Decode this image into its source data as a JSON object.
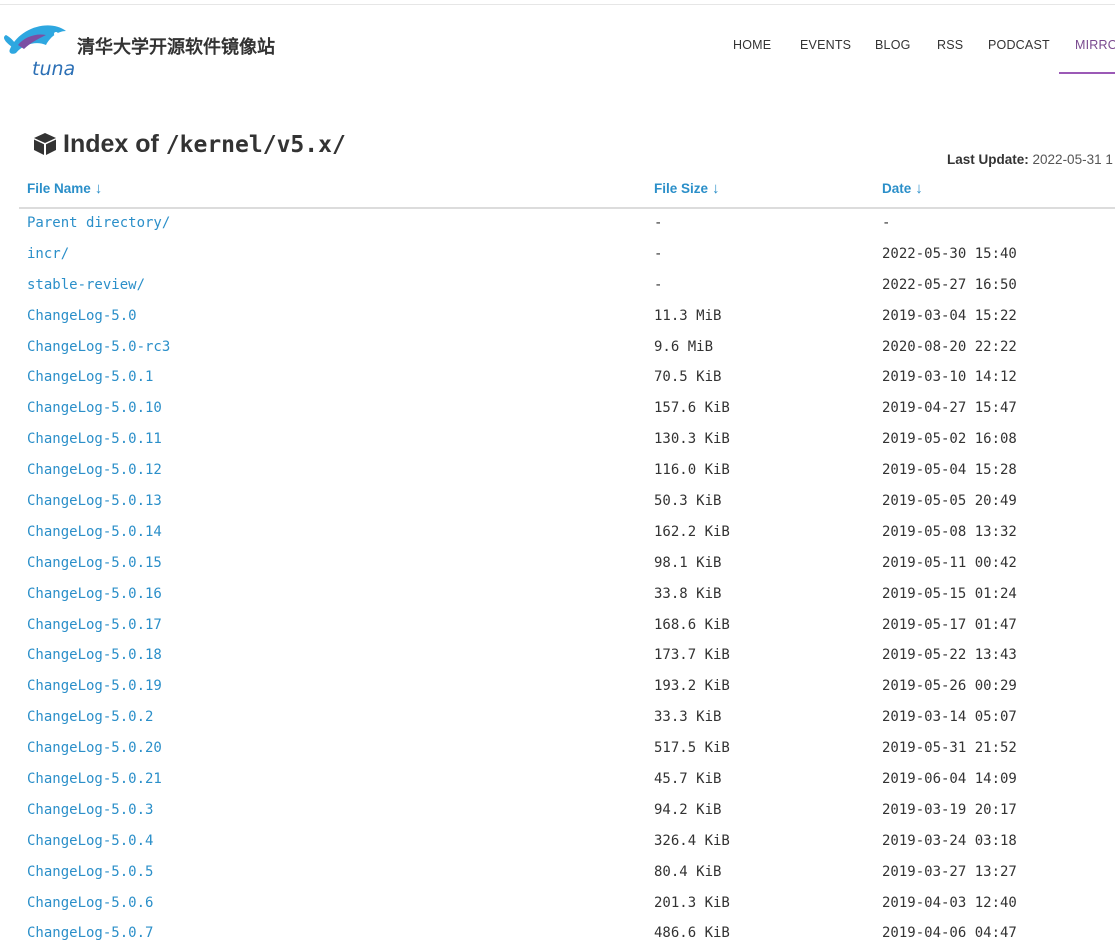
{
  "header": {
    "site_title": "清华大学开源软件镜像站",
    "logo_text": "tuna",
    "nav": [
      "HOME",
      "EVENTS",
      "BLOG",
      "RSS",
      "PODCAST",
      "MIRRO"
    ],
    "active_nav": "MIRRO",
    "accent_color": "#9b59b6"
  },
  "index": {
    "title_prefix": "Index of",
    "path": "/kernel/v5.x/",
    "icon": "cube-icon"
  },
  "last_update": {
    "label": "Last Update:",
    "value": "2022-05-31 1"
  },
  "table": {
    "headers": {
      "name": "File Name",
      "size": "File Size",
      "date": "Date",
      "sort_arrow": "↓"
    },
    "rows": [
      {
        "name": "Parent directory/",
        "size": "-",
        "date": "-"
      },
      {
        "name": "incr/",
        "size": "-",
        "date": "2022-05-30 15:40"
      },
      {
        "name": "stable-review/",
        "size": "-",
        "date": "2022-05-27 16:50"
      },
      {
        "name": "ChangeLog-5.0",
        "size": "11.3 MiB",
        "date": "2019-03-04 15:22"
      },
      {
        "name": "ChangeLog-5.0-rc3",
        "size": "9.6 MiB",
        "date": "2020-08-20 22:22"
      },
      {
        "name": "ChangeLog-5.0.1",
        "size": "70.5 KiB",
        "date": "2019-03-10 14:12"
      },
      {
        "name": "ChangeLog-5.0.10",
        "size": "157.6 KiB",
        "date": "2019-04-27 15:47"
      },
      {
        "name": "ChangeLog-5.0.11",
        "size": "130.3 KiB",
        "date": "2019-05-02 16:08"
      },
      {
        "name": "ChangeLog-5.0.12",
        "size": "116.0 KiB",
        "date": "2019-05-04 15:28"
      },
      {
        "name": "ChangeLog-5.0.13",
        "size": "50.3 KiB",
        "date": "2019-05-05 20:49"
      },
      {
        "name": "ChangeLog-5.0.14",
        "size": "162.2 KiB",
        "date": "2019-05-08 13:32"
      },
      {
        "name": "ChangeLog-5.0.15",
        "size": "98.1 KiB",
        "date": "2019-05-11 00:42"
      },
      {
        "name": "ChangeLog-5.0.16",
        "size": "33.8 KiB",
        "date": "2019-05-15 01:24"
      },
      {
        "name": "ChangeLog-5.0.17",
        "size": "168.6 KiB",
        "date": "2019-05-17 01:47"
      },
      {
        "name": "ChangeLog-5.0.18",
        "size": "173.7 KiB",
        "date": "2019-05-22 13:43"
      },
      {
        "name": "ChangeLog-5.0.19",
        "size": "193.2 KiB",
        "date": "2019-05-26 00:29"
      },
      {
        "name": "ChangeLog-5.0.2",
        "size": "33.3 KiB",
        "date": "2019-03-14 05:07"
      },
      {
        "name": "ChangeLog-5.0.20",
        "size": "517.5 KiB",
        "date": "2019-05-31 21:52"
      },
      {
        "name": "ChangeLog-5.0.21",
        "size": "45.7 KiB",
        "date": "2019-06-04 14:09"
      },
      {
        "name": "ChangeLog-5.0.3",
        "size": "94.2 KiB",
        "date": "2019-03-19 20:17"
      },
      {
        "name": "ChangeLog-5.0.4",
        "size": "326.4 KiB",
        "date": "2019-03-24 03:18"
      },
      {
        "name": "ChangeLog-5.0.5",
        "size": "80.4 KiB",
        "date": "2019-03-27 13:27"
      },
      {
        "name": "ChangeLog-5.0.6",
        "size": "201.3 KiB",
        "date": "2019-04-03 12:40"
      },
      {
        "name": "ChangeLog-5.0.7",
        "size": "486.6 KiB",
        "date": "2019-04-06 04:47"
      }
    ]
  }
}
